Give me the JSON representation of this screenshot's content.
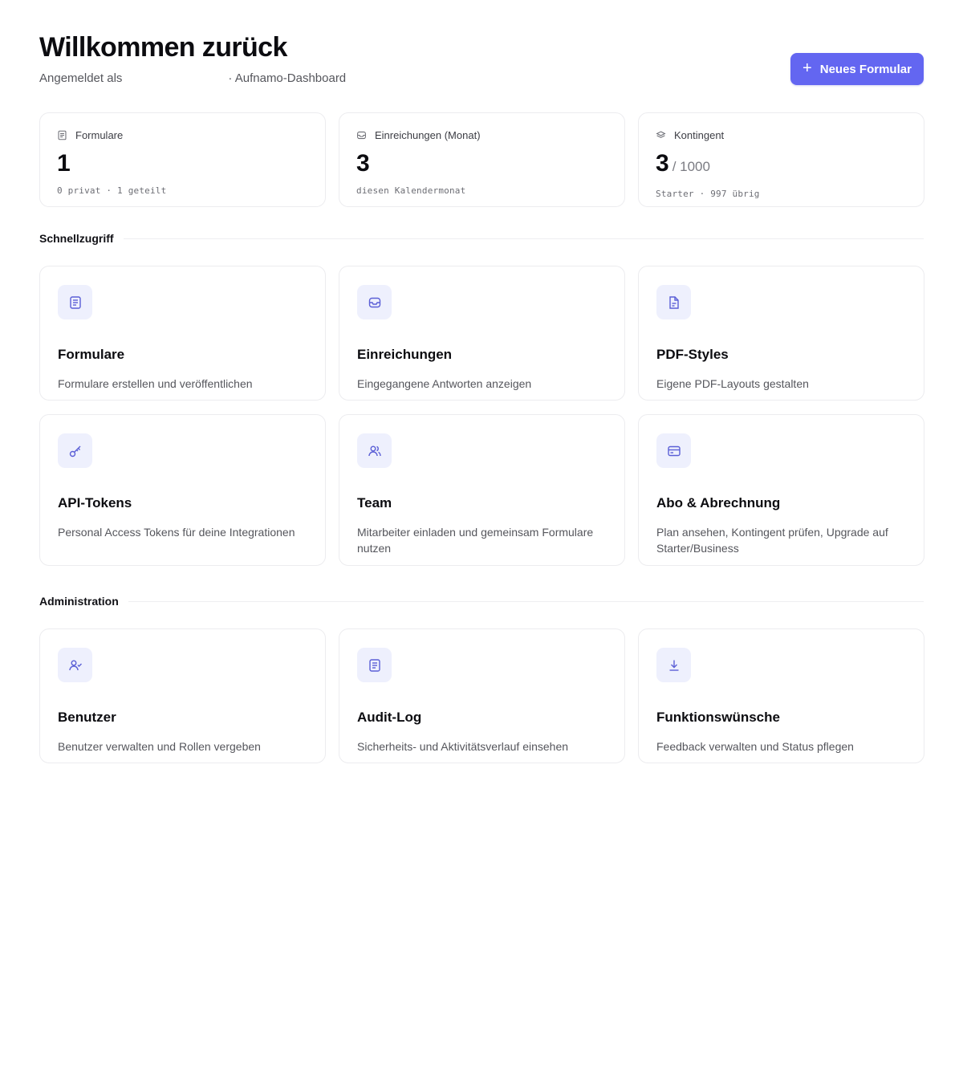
{
  "header": {
    "title": "Willkommen zurück",
    "subtitle_prefix": "Angemeldet als",
    "subtitle_suffix": "· Aufnamo-Dashboard",
    "new_form_label": "Neues Formular"
  },
  "stats": [
    {
      "label": "Formulare",
      "value": "1",
      "value_sub": "",
      "meta": "0 privat · 1 geteilt",
      "icon": "document-icon"
    },
    {
      "label": "Einreichungen (Monat)",
      "value": "3",
      "value_sub": "",
      "meta": "diesen Kalendermonat",
      "icon": "inbox-icon"
    },
    {
      "label": "Kontingent",
      "value": "3",
      "value_sub": "/ 1000",
      "meta": "Starter · 997 übrig",
      "icon": "layers-icon"
    }
  ],
  "sections": {
    "quick": "Schnellzugriff",
    "admin": "Administration"
  },
  "quick_cards": [
    {
      "title": "Formulare",
      "desc": "Formulare erstellen und veröffentlichen",
      "icon": "document-icon"
    },
    {
      "title": "Einreichungen",
      "desc": "Eingegangene Antworten anzeigen",
      "icon": "inbox-icon"
    },
    {
      "title": "PDF-Styles",
      "desc": "Eigene PDF-Layouts gestalten",
      "icon": "file-icon"
    },
    {
      "title": "API-Tokens",
      "desc": "Personal Access Tokens für deine Integrationen",
      "icon": "key-icon"
    },
    {
      "title": "Team",
      "desc": "Mitarbeiter einladen und gemeinsam Formulare nutzen",
      "icon": "users-icon"
    },
    {
      "title": "Abo & Abrechnung",
      "desc": "Plan ansehen, Kontingent prüfen, Upgrade auf Starter/Business",
      "icon": "credit-card-icon"
    }
  ],
  "admin_cards": [
    {
      "title": "Benutzer",
      "desc": "Benutzer verwalten und Rollen vergeben",
      "icon": "user-check-icon"
    },
    {
      "title": "Audit-Log",
      "desc": "Sicherheits- und Aktivitätsverlauf einsehen",
      "icon": "document-icon"
    },
    {
      "title": "Funktionswünsche",
      "desc": "Feedback verwalten und Status pflegen",
      "icon": "download-icon"
    }
  ],
  "colors": {
    "accent": "#6366f1",
    "icon_bg": "#eef0fd",
    "icon_stroke": "#5b5fd6",
    "border": "#ececef"
  }
}
